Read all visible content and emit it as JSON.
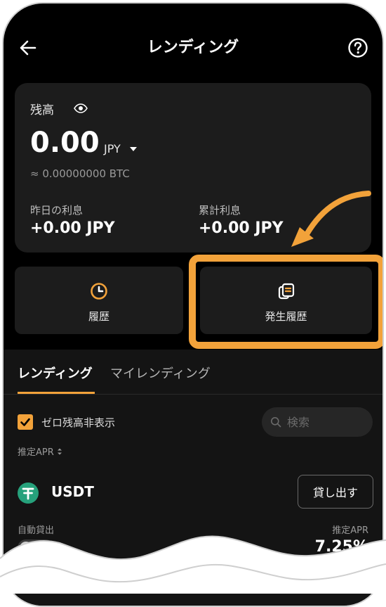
{
  "header": {
    "title": "レンディング",
    "back_icon": "arrow-left-icon",
    "help_icon": "question-circle-icon"
  },
  "balance": {
    "label": "残高",
    "value": "0.00",
    "currency": "JPY",
    "btc_equivalent": "≈ 0.00000000 BTC"
  },
  "interest": {
    "yesterday_label": "昨日の利息",
    "yesterday_value": "+0.00 JPY",
    "total_label": "累計利息",
    "total_value": "+0.00 JPY"
  },
  "actions": [
    {
      "label": "履歴",
      "icon": "clock-icon"
    },
    {
      "label": "発生履歴",
      "icon": "documents-icon"
    }
  ],
  "tabs": [
    {
      "label": "レンディング",
      "active": true
    },
    {
      "label": "マイレンディング",
      "active": false
    }
  ],
  "filters": {
    "hide_zero_label": "ゼロ残高非表示",
    "hide_zero_checked": true,
    "search_placeholder": "検索",
    "sort_label": "推定APR"
  },
  "asset": {
    "name": "USDT",
    "lend_button": "貸し出す",
    "auto_lend_label": "自動貸出",
    "apr_label": "推定APR",
    "apr_value": "7.25%"
  },
  "colors": {
    "accent": "#f2a23a",
    "card": "#1c1c1c",
    "usdt": "#26a17b"
  }
}
